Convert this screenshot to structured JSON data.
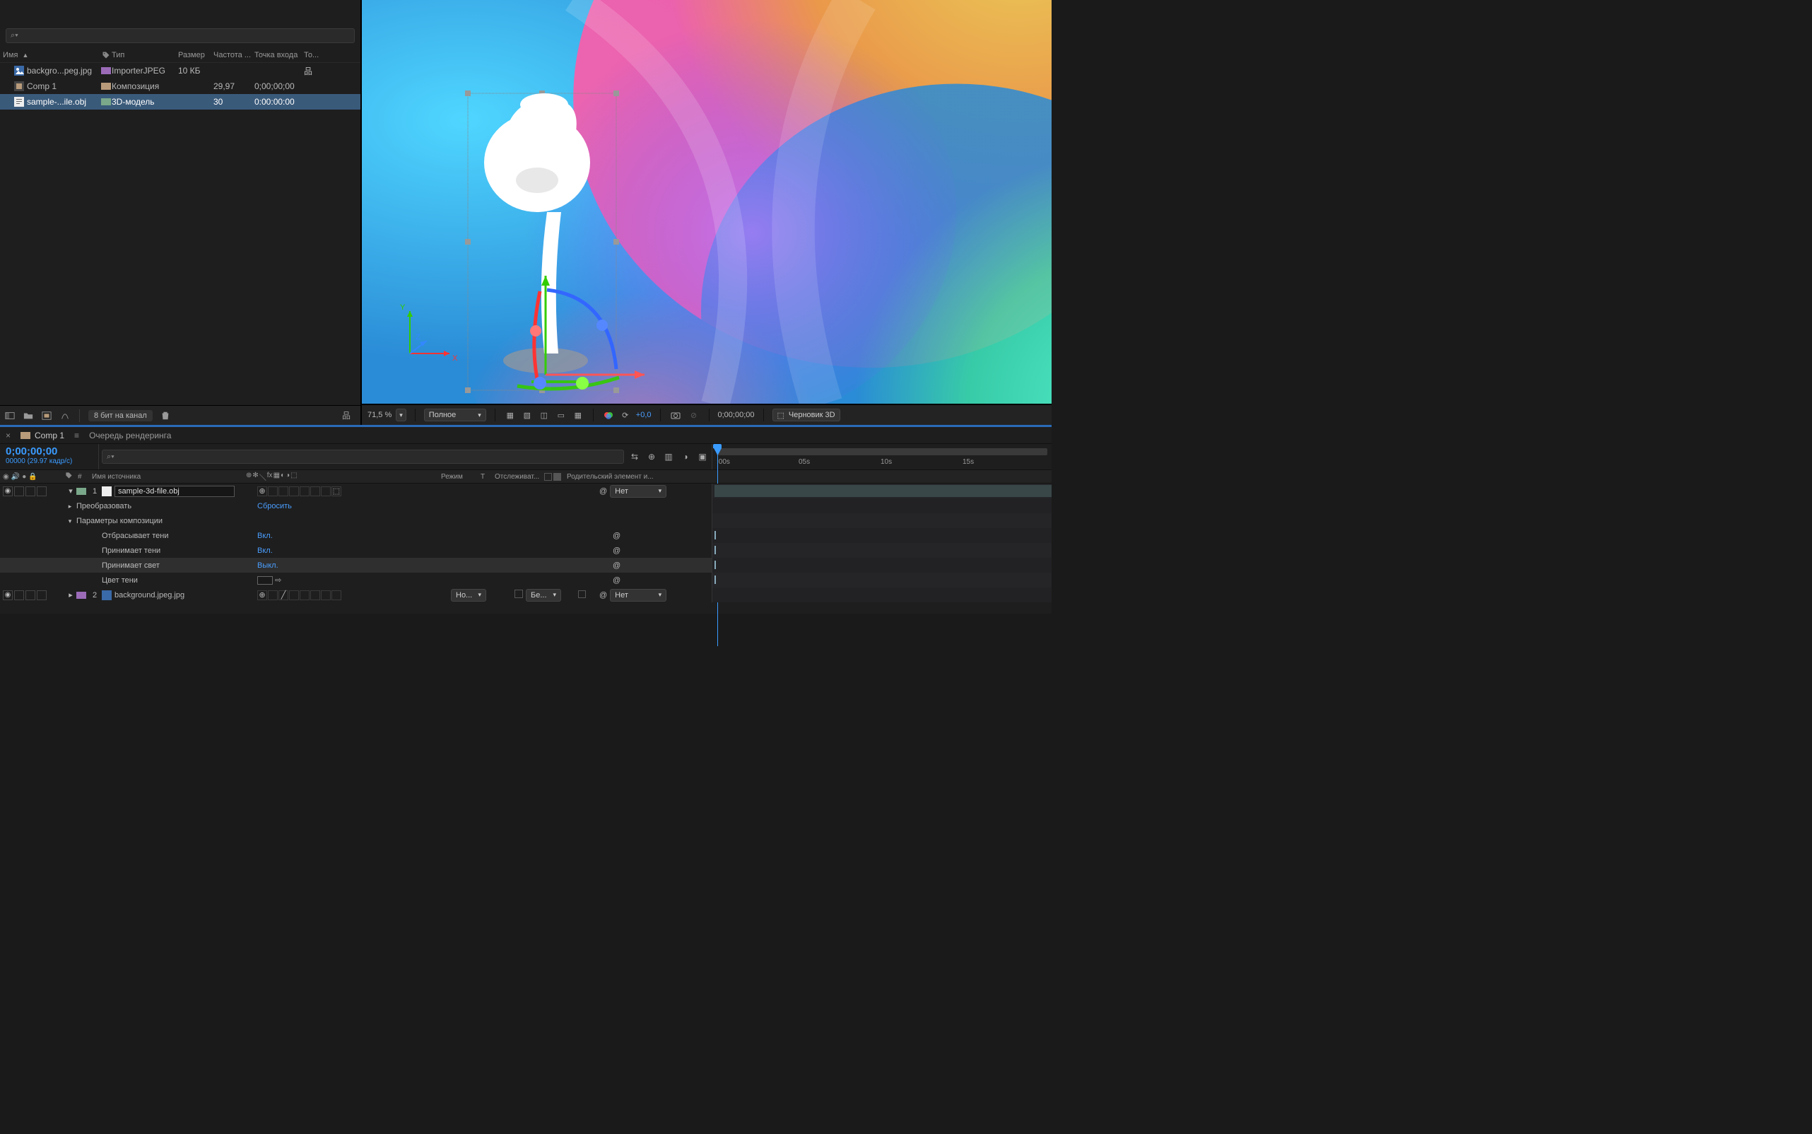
{
  "project": {
    "search_placeholder": "",
    "search_prefix": "⌕",
    "cols": {
      "name": "Имя",
      "tag": "",
      "type": "Тип",
      "size": "Размер",
      "rate": "Частота ...",
      "in": "Точка входа",
      "out": "То..."
    },
    "items": [
      {
        "name": "backgro...peg.jpg",
        "label": "#9b6bb8",
        "icon": "img",
        "type": "ImporterJPEG",
        "size": "10 КБ",
        "rate": "",
        "in": "",
        "sel": false,
        "share": true
      },
      {
        "name": "Comp 1",
        "label": "#b89b7a",
        "icon": "comp",
        "type": "Композиция",
        "size": "",
        "rate": "29,97",
        "in": "0;00;00;00",
        "sel": false
      },
      {
        "name": "sample-...ile.obj",
        "label": "#7aa88a",
        "icon": "file",
        "type": "3D-модель",
        "size": "",
        "rate": "30",
        "in": "0:00:00:00",
        "sel": true
      }
    ],
    "bpc": "8 бит на канал"
  },
  "preview": {
    "zoom": "71,5 %",
    "quality": "Полное",
    "exposure": "+0,0",
    "timecode": "0;00;00;00",
    "draft3d": "Черновик 3D"
  },
  "timeline": {
    "tabs": {
      "comp": "Comp 1",
      "queue": "Очередь рендеринга"
    },
    "current_tc": "0;00;00;00",
    "current_sub": "00000 (29.97 кадр/с)",
    "search_placeholder": "",
    "col_hdr": {
      "src": "Имя источника",
      "mode": "Режим",
      "t": "T",
      "track": "Отслеживат...",
      "parent": "Родительский элемент и..."
    },
    "ruler": {
      "t0": ":00s",
      "t1": "05s",
      "t2": "10s",
      "t3": "15s"
    },
    "rows": [
      {
        "idx": "1",
        "label": "#7aa88a",
        "name": "sample-3d-file.obj",
        "editable": true,
        "parent": "Нет",
        "hasClip": true,
        "eye": true,
        "chev": "▾"
      },
      {
        "prop": true,
        "twirl": "▸",
        "name": "Преобразовать",
        "val": "Сбросить"
      },
      {
        "prop": true,
        "twirl": "▾",
        "name": "Параметры композиции",
        "val": ""
      },
      {
        "prop": true,
        "sub": true,
        "name": "Отбрасывает тени",
        "val": "Вкл.",
        "spiral": true,
        "kf": true
      },
      {
        "prop": true,
        "sub": true,
        "name": "Принимает тени",
        "val": "Вкл.",
        "spiral": true,
        "kf": true
      },
      {
        "prop": true,
        "sub": true,
        "name": "Принимает свет",
        "val": "Выкл.",
        "spiral": true,
        "kf": true,
        "sel": true
      },
      {
        "prop": true,
        "sub": true,
        "name": "Цвет тени",
        "val": "",
        "swatch": "#1a1a1a",
        "spiral": true,
        "kf": true
      },
      {
        "idx": "2",
        "label": "#9b6bb8",
        "name": "background.jpeg.jpg",
        "mode": "Но...",
        "trk": "Бе...",
        "parent": "Нет",
        "eye": true,
        "chev": "▸"
      }
    ]
  }
}
